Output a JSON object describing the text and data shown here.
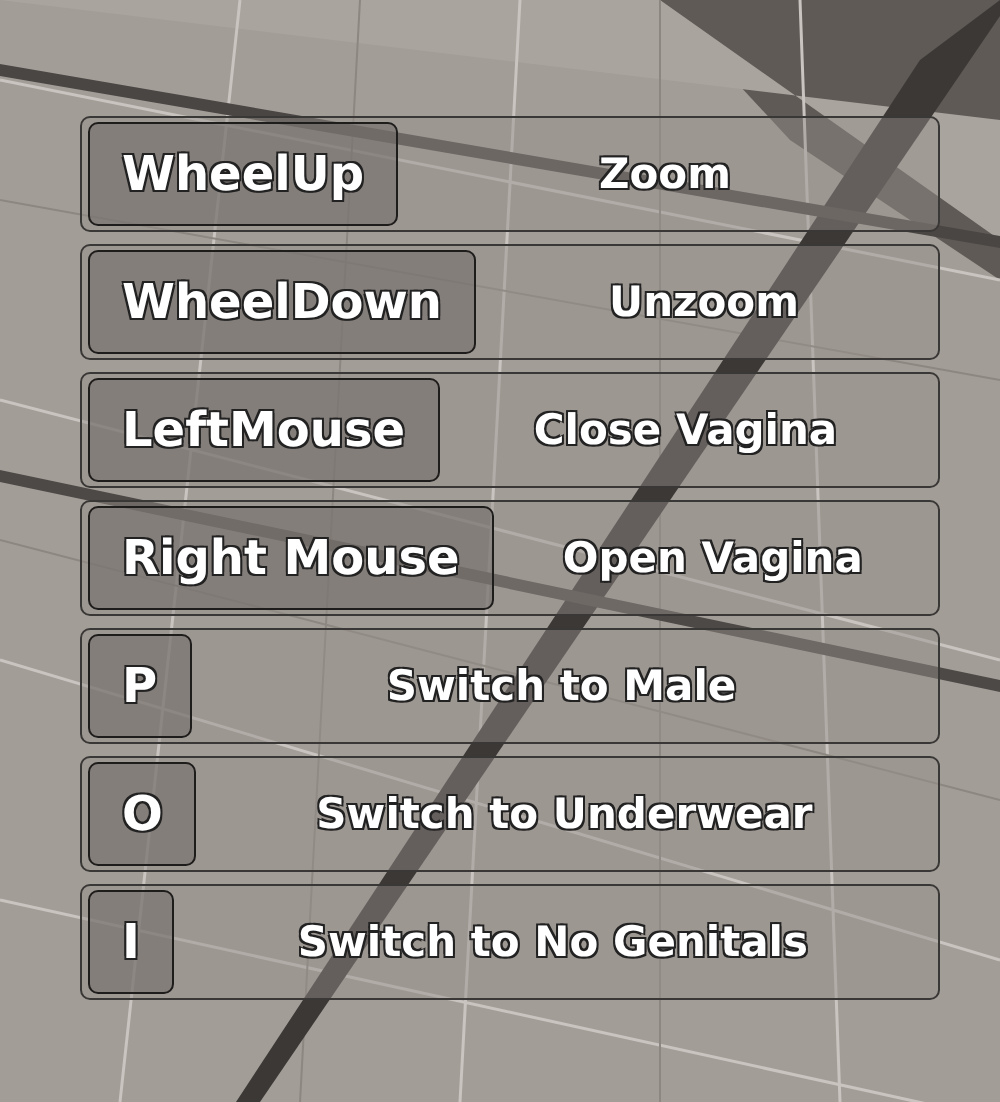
{
  "bindings": [
    {
      "key": "WheelUp",
      "action": "Zoom"
    },
    {
      "key": "WheelDown",
      "action": "Unzoom"
    },
    {
      "key": "LeftMouse",
      "action": "Close Vagina"
    },
    {
      "key": "Right Mouse",
      "action": "Open Vagina"
    },
    {
      "key": "P",
      "action": "Switch to Male"
    },
    {
      "key": "O",
      "action": "Switch to Underwear"
    },
    {
      "key": "I",
      "action": "Switch to No Genitals"
    }
  ]
}
